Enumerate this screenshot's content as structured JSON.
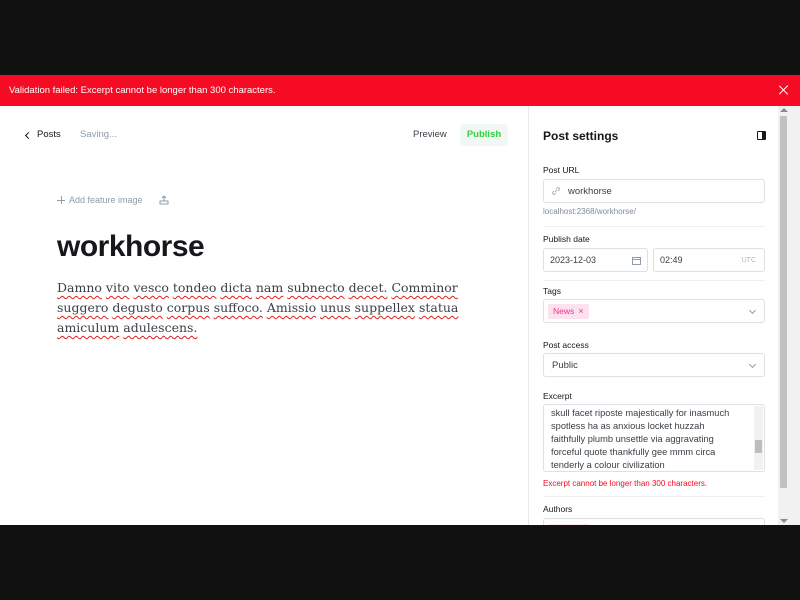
{
  "alert": {
    "message": "Validation failed: Excerpt cannot be longer than 300 characters.",
    "color": "#f50b23"
  },
  "topbar": {
    "back_label": "Posts",
    "status": "Saving...",
    "preview_label": "Preview",
    "publish_label": "Publish"
  },
  "editor": {
    "feature_image_label": "Add feature image",
    "title": "workhorse",
    "body_words": [
      "Damno",
      "vito",
      "vesco",
      "tondeo",
      "dicta",
      "nam",
      "subnecto",
      "decet.",
      "Comminor",
      "suggero",
      "degusto",
      "corpus",
      "suffoco.",
      "Amissio",
      "unus",
      "suppellex",
      "statua",
      "amiculum",
      "adulescens."
    ]
  },
  "settings": {
    "title": "Post settings",
    "url_label": "Post URL",
    "url_value": "workhorse",
    "url_hint": "localhost:2368/workhorse/",
    "date_label": "Publish date",
    "date_value": "2023-12-03",
    "time_value": "02:49",
    "timezone": "UTC",
    "tags_label": "Tags",
    "tags": [
      "News"
    ],
    "access_label": "Post access",
    "access_value": "Public",
    "excerpt_label": "Excerpt",
    "excerpt_lines": [
      "skull facet riposte majestically for inasmuch",
      "spotless ha as anxious locket huzzah",
      "faithfully plumb unsettle via aggravating",
      "forceful quote thankfully gee mmm circa",
      "tenderly a colour civilization"
    ],
    "excerpt_error": "Excerpt cannot be longer than 300 characters.",
    "authors_label": "Authors"
  },
  "colors": {
    "publish_green": "#30cf43",
    "tag_pink": "#fb2d8d",
    "error_red": "#f50b23"
  }
}
